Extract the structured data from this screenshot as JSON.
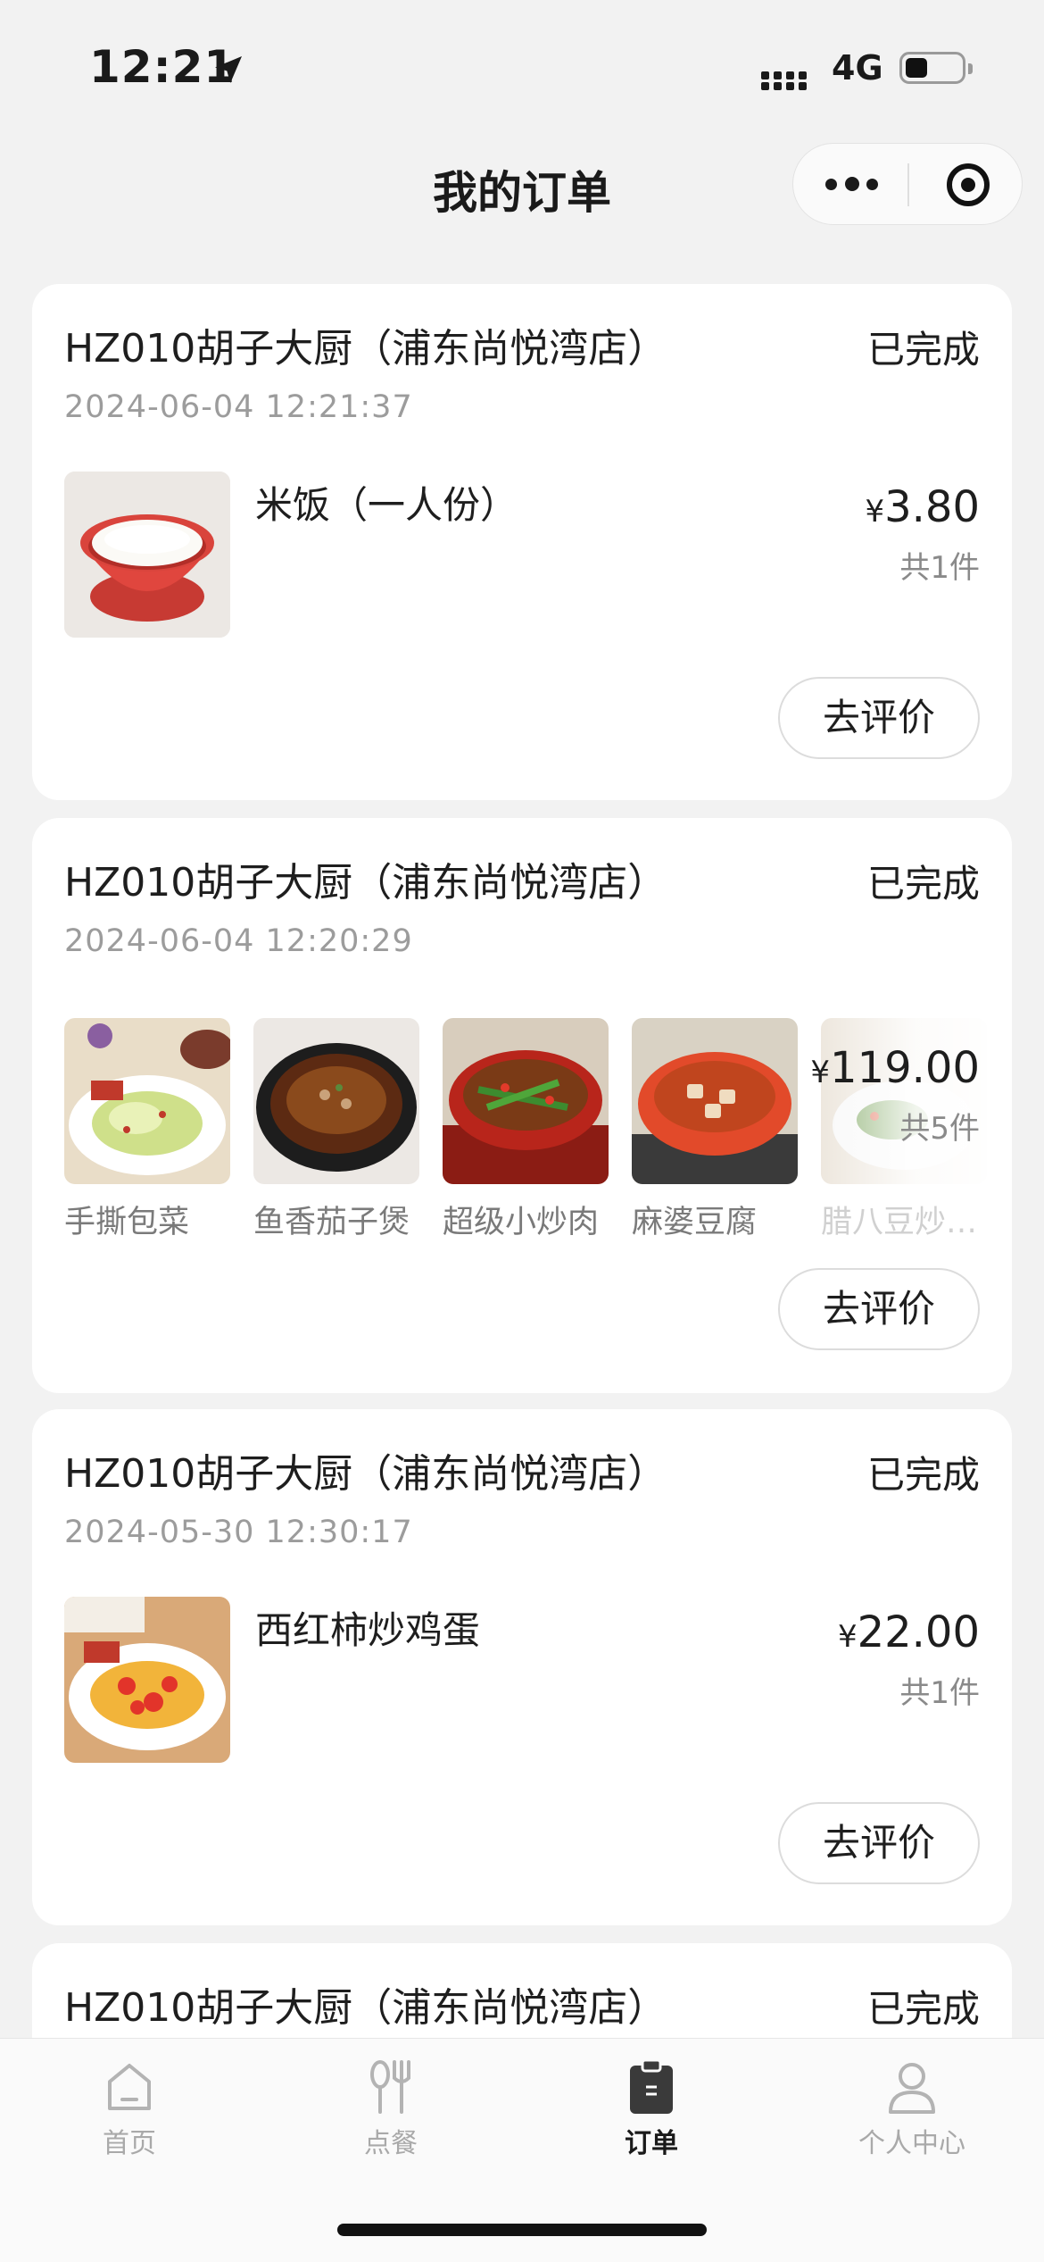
{
  "status_bar": {
    "time": "12:21",
    "network": "4G"
  },
  "header": {
    "title": "我的订单",
    "capsule_more_icon": "more-dots-icon",
    "capsule_close_icon": "target-circle-icon"
  },
  "orders": [
    {
      "store": "HZ010胡子大厨（浦东尚悦湾店）",
      "status": "已完成",
      "datetime": "2024-06-04 12:21:37",
      "item_name": "米饭（一人份）",
      "price_symbol": "¥",
      "price": "3.80",
      "count": "共1件",
      "action": "去评价"
    },
    {
      "store": "HZ010胡子大厨（浦东尚悦湾店）",
      "status": "已完成",
      "datetime": "2024-06-04 12:20:29",
      "dishes": [
        "手撕包菜",
        "鱼香茄子煲",
        "超级小炒肉",
        "麻婆豆腐",
        "腊八豆炒…"
      ],
      "price_symbol": "¥",
      "price": "119.00",
      "count": "共5件",
      "action": "去评价"
    },
    {
      "store": "HZ010胡子大厨（浦东尚悦湾店）",
      "status": "已完成",
      "datetime": "2024-05-30 12:30:17",
      "item_name": "西红柿炒鸡蛋",
      "price_symbol": "¥",
      "price": "22.00",
      "count": "共1件",
      "action": "去评价"
    },
    {
      "store": "HZ010胡子大厨（浦东尚悦湾店）",
      "status": "已完成"
    }
  ],
  "tabbar": {
    "items": [
      {
        "label": "首页",
        "icon": "home-icon",
        "active": false
      },
      {
        "label": "点餐",
        "icon": "utensils-icon",
        "active": false
      },
      {
        "label": "订单",
        "icon": "clipboard-icon",
        "active": true
      },
      {
        "label": "个人中心",
        "icon": "user-icon",
        "active": false
      }
    ]
  }
}
